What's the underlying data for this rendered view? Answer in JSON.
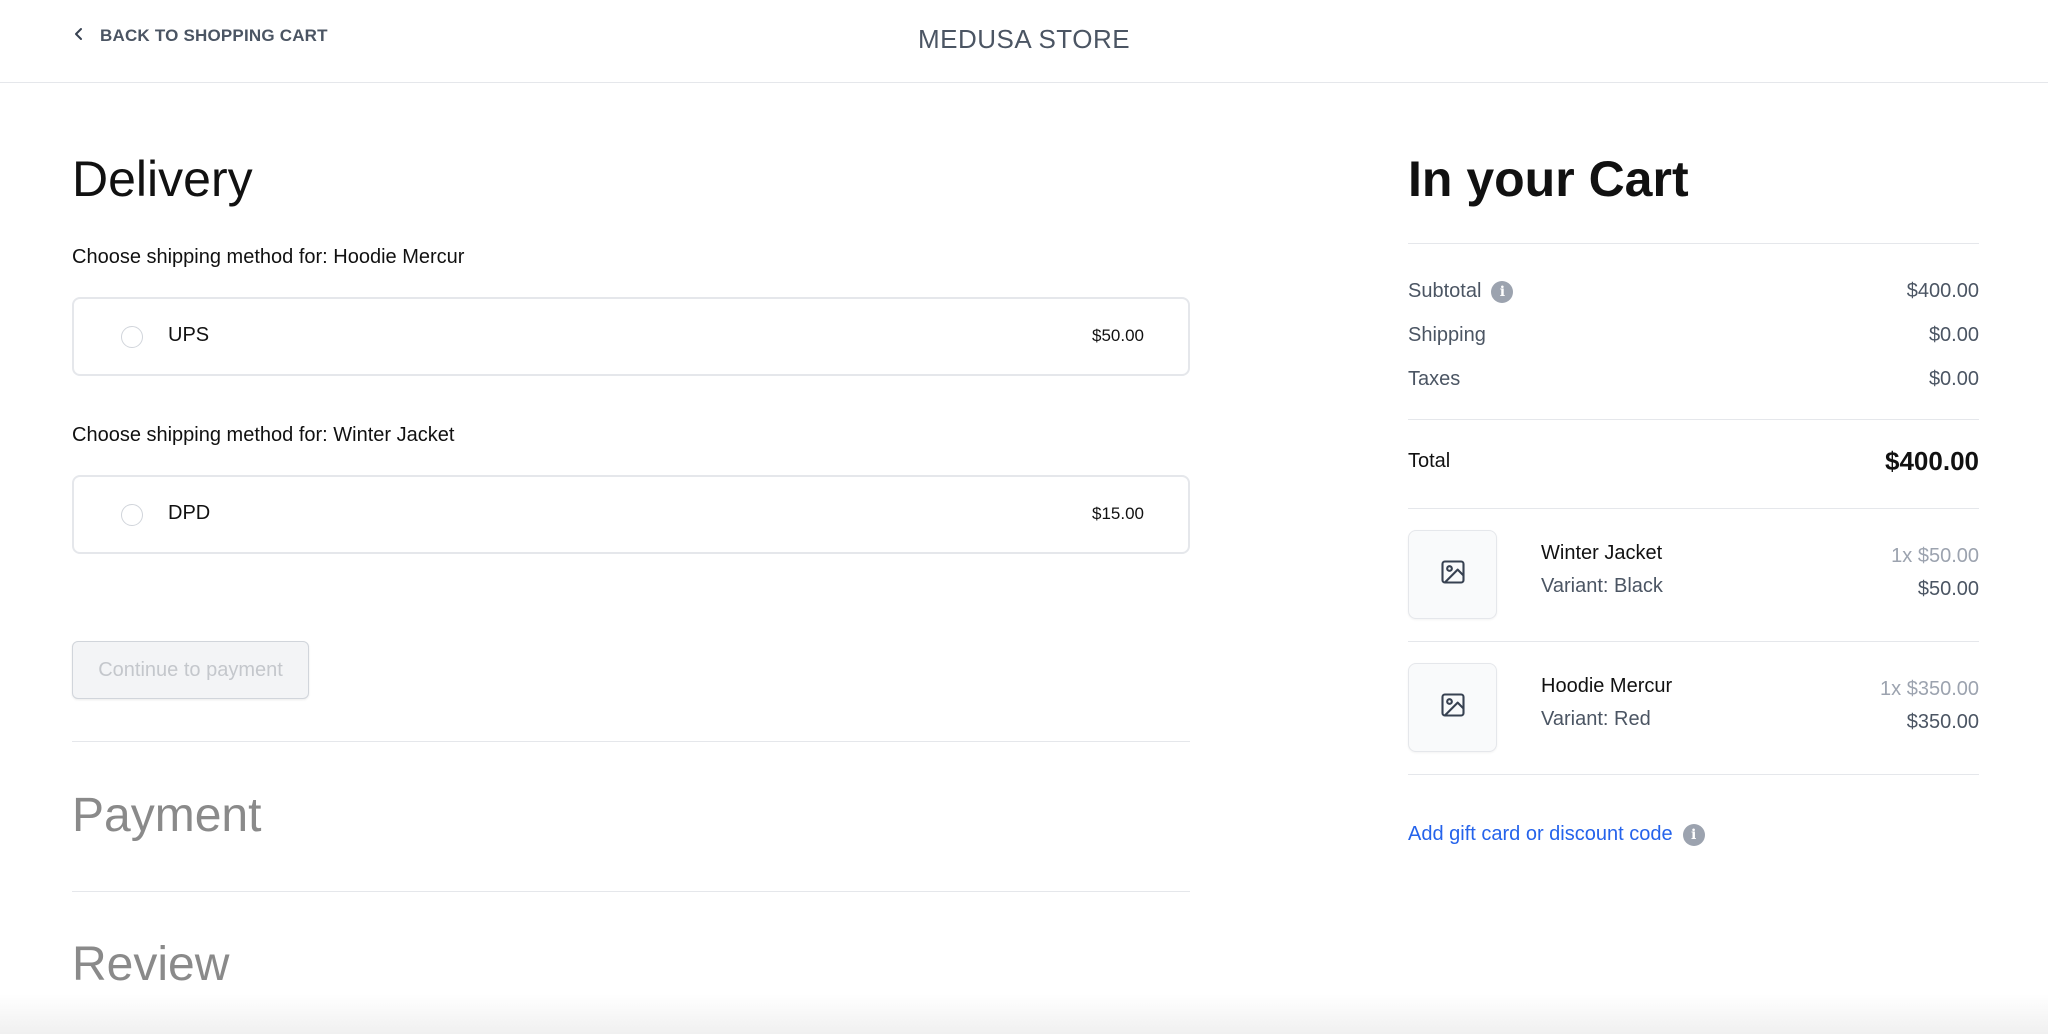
{
  "header": {
    "back_label": "BACK TO SHOPPING CART",
    "store_title": "MEDUSA STORE"
  },
  "delivery": {
    "title": "Delivery",
    "groups": [
      {
        "label": "Choose shipping method for: Hoodie Mercur",
        "method": "UPS",
        "price": "$50.00",
        "selected": false
      },
      {
        "label": "Choose shipping method for: Winter Jacket",
        "method": "DPD",
        "price": "$15.00",
        "selected": false
      }
    ],
    "continue_label": "Continue to payment",
    "continue_disabled": true
  },
  "steps": {
    "payment_title": "Payment",
    "review_title": "Review"
  },
  "cart": {
    "title": "In your Cart",
    "summary": {
      "subtotal_label": "Subtotal",
      "subtotal_value": "$400.00",
      "shipping_label": "Shipping",
      "shipping_value": "$0.00",
      "taxes_label": "Taxes",
      "taxes_value": "$0.00",
      "total_label": "Total",
      "total_value": "$400.00"
    },
    "items": [
      {
        "name": "Winter Jacket",
        "variant": "Variant: Black",
        "unit": "1x $50.00",
        "total": "$50.00",
        "thumb_icon": "image-placeholder-icon"
      },
      {
        "name": "Hoodie Mercur",
        "variant": "Variant: Red",
        "unit": "1x $350.00",
        "total": "$350.00",
        "thumb_icon": "image-placeholder-icon"
      }
    ],
    "gift_link_label": "Add gift card or discount code"
  },
  "colors": {
    "link": "#2563eb",
    "muted_heading": "#8a8a8a",
    "border": "#e5e7eb"
  }
}
